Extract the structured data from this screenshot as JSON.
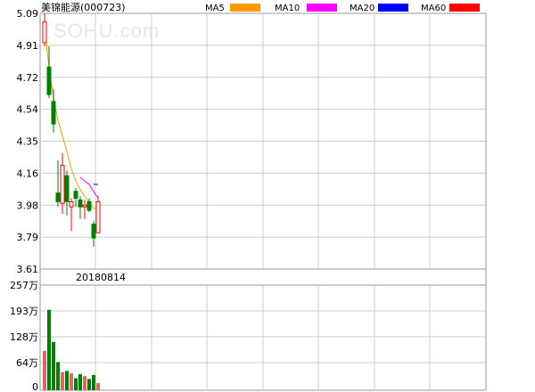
{
  "header": {
    "stock_title": "美锦能源(000723)",
    "watermark": "SOHU.com",
    "ma_legend": [
      {
        "label": "MA5",
        "color": "#ff9900"
      },
      {
        "label": "MA10",
        "color": "#ff00ff"
      },
      {
        "label": "MA20",
        "color": "#0000ff"
      },
      {
        "label": "MA60",
        "color": "#ff0000"
      }
    ]
  },
  "colors": {
    "up": "#ff0000",
    "down": "#008000",
    "grid": "#cccccc",
    "border": "#999999",
    "volume_up": "#e06666",
    "volume_down": "#008000"
  },
  "chart_data": [
    {
      "type": "candlestick",
      "title": "美锦能源(000723)",
      "ylim": [
        3.61,
        5.09
      ],
      "y_ticks": [
        "5.09",
        "4.91",
        "4.72",
        "4.54",
        "4.35",
        "4.16",
        "3.98",
        "3.79",
        "3.61"
      ],
      "x_tick_label": "20180814",
      "grid": true,
      "candles": [
        {
          "o": 4.92,
          "h": 5.09,
          "l": 4.9,
          "c": 5.04
        },
        {
          "o": 4.78,
          "h": 4.9,
          "l": 4.6,
          "c": 4.62
        },
        {
          "o": 4.58,
          "h": 4.65,
          "l": 4.4,
          "c": 4.45
        },
        {
          "o": 4.05,
          "h": 4.24,
          "l": 3.97,
          "c": 4.0
        },
        {
          "o": 3.99,
          "h": 4.28,
          "l": 3.93,
          "c": 4.21
        },
        {
          "o": 4.15,
          "h": 4.18,
          "l": 3.92,
          "c": 4.0
        },
        {
          "o": 3.97,
          "h": 4.02,
          "l": 3.83,
          "c": 4.0
        },
        {
          "o": 4.06,
          "h": 4.08,
          "l": 3.97,
          "c": 4.02
        },
        {
          "o": 4.01,
          "h": 4.03,
          "l": 3.9,
          "c": 3.97
        },
        {
          "o": 3.97,
          "h": 4.01,
          "l": 3.9,
          "c": 3.98
        },
        {
          "o": 4.0,
          "h": 4.02,
          "l": 3.94,
          "c": 3.95
        },
        {
          "o": 3.87,
          "h": 3.89,
          "l": 3.74,
          "c": 3.79
        },
        {
          "o": 3.82,
          "h": 4.03,
          "l": 3.82,
          "c": 4.0
        }
      ],
      "ma5": [
        5.0,
        4.78,
        4.6,
        4.47,
        4.38,
        4.29,
        4.19,
        4.12,
        4.07,
        4.03,
        4.0,
        3.96,
        3.96
      ],
      "ma10": [
        null,
        null,
        null,
        null,
        null,
        null,
        null,
        null,
        4.14,
        4.12,
        4.1,
        4.06,
        4.02
      ],
      "ma20": [
        null,
        null,
        null,
        null,
        null,
        null,
        null,
        null,
        null,
        null,
        null,
        4.1,
        4.1
      ]
    },
    {
      "type": "bar",
      "title": "",
      "ylim": [
        0,
        257
      ],
      "y_ticks": [
        "257万",
        "193万",
        "128万",
        "64万",
        "0"
      ],
      "volumes": [
        98,
        200,
        120,
        70,
        45,
        48,
        42,
        30,
        40,
        35,
        28,
        38,
        18
      ]
    }
  ]
}
